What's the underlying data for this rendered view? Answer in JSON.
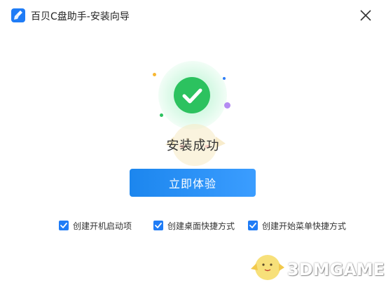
{
  "window": {
    "title": "百贝C盘助手-安装向导",
    "app_icon": "broom-icon",
    "close_icon": "close-icon"
  },
  "result": {
    "icon": "check-circle-icon",
    "message": "安装成功"
  },
  "primary_action": {
    "label": "立即体验"
  },
  "options": [
    {
      "label": "创建开机启动项",
      "checked": true
    },
    {
      "label": "创建桌面快捷方式",
      "checked": true
    },
    {
      "label": "创建开始菜单快捷方式",
      "checked": true
    }
  ],
  "watermark": {
    "text": "3DMGAME"
  },
  "colors": {
    "accent": "#1f7cf6",
    "success": "#2cc25f",
    "button_gradient_start": "#1c86ee",
    "button_gradient_end": "#3b9dff"
  }
}
